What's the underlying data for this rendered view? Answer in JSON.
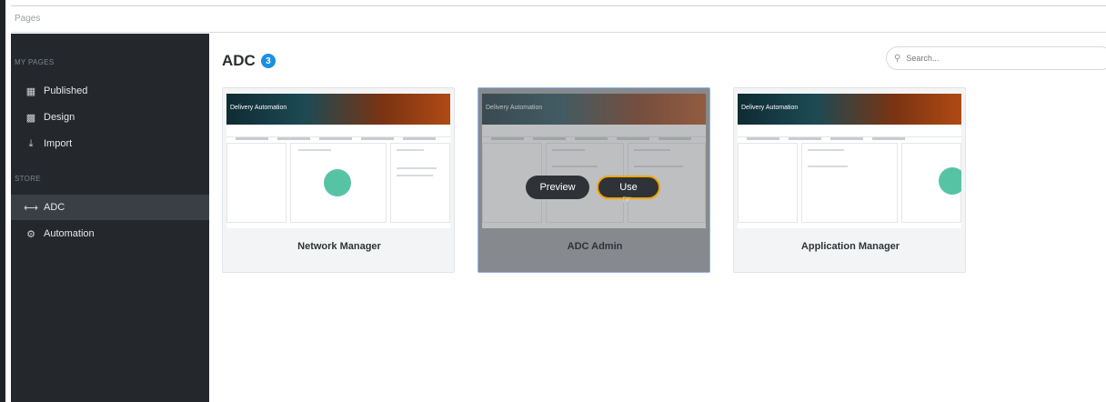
{
  "window": {
    "title": "Pages"
  },
  "sidebar": {
    "section_my_pages": "MY PAGES",
    "section_store": "STORE",
    "items": [
      {
        "label": "Published",
        "icon": "document-icon"
      },
      {
        "label": "Design",
        "icon": "design-icon"
      },
      {
        "label": "Import",
        "icon": "import-icon"
      },
      {
        "label": "ADC",
        "icon": "adc-icon",
        "active": true
      },
      {
        "label": "Automation",
        "icon": "automation-icon"
      }
    ]
  },
  "main": {
    "title": "ADC",
    "count": "3",
    "search_placeholder": "Search..."
  },
  "cards": [
    {
      "name": "Network Manager",
      "banner": "Delivery Automation"
    },
    {
      "name": "ADC Admin",
      "banner": "Delivery Automation",
      "preview_label": "Preview",
      "use_label": "Use"
    },
    {
      "name": "Application Manager",
      "banner": "Delivery Automation"
    }
  ],
  "colors": {
    "sidebar_bg": "#24282d",
    "accent_badge": "#1d8fe3",
    "use_highlight": "#f0a500",
    "chart_green": "#57c3a5"
  }
}
